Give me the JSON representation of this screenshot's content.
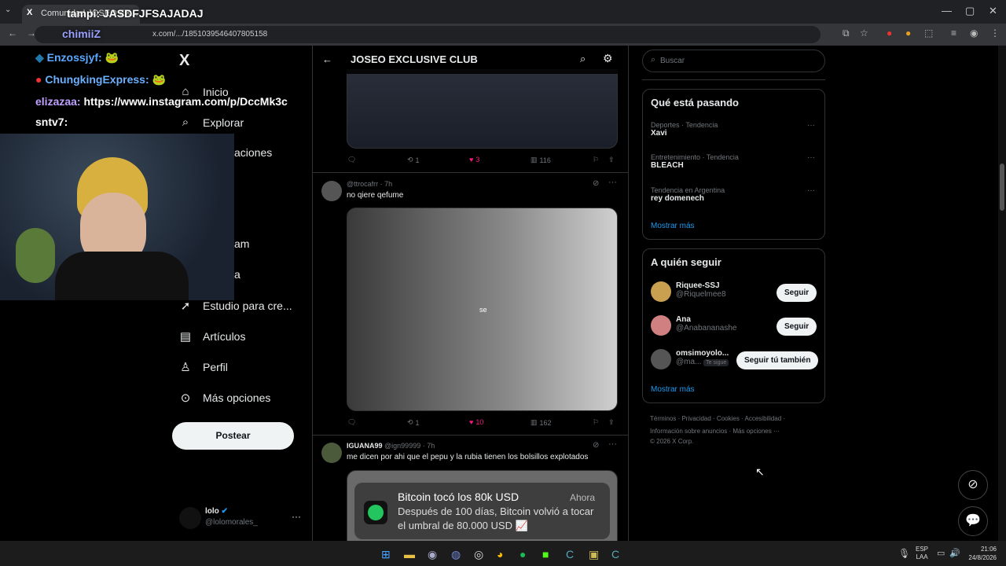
{
  "browser": {
    "tab_title": "Comunidad JOSEO EX...",
    "url": "x.com/.../1851039546407805158",
    "window_controls": {
      "minimize": "—",
      "maximize": "▢",
      "close": "✕"
    }
  },
  "overlay": {
    "chat": [
      {
        "user": "tampi",
        "text": ": JASDFJFSAJADAJ",
        "color": "#ffffff"
      },
      {
        "user": "chimiiZ",
        "text": "",
        "color": "#9aa0ff"
      },
      {
        "user": "Enzossjyf:",
        "text": "",
        "color": "#5aa8ff"
      },
      {
        "user": "ChungkingExpress:",
        "text": "",
        "color": "#6ab0ff"
      },
      {
        "user": "elizazaa:",
        "text": " https://www.instagram.com/p/DccMk3c",
        "color": "#c0a0ff"
      },
      {
        "user": "sntv7:",
        "text": "",
        "color": "#ffffff"
      }
    ]
  },
  "sidebar": {
    "logo": "X",
    "items": [
      {
        "label": "Inicio",
        "icon": "home-icon"
      },
      {
        "label": "Explorar",
        "icon": "search-icon"
      },
      {
        "label": "aciones",
        "icon": "bell-icon"
      },
      {
        "label": "am",
        "icon": "grok-icon"
      },
      {
        "label": "a",
        "icon": "bookmark-icon"
      },
      {
        "label": "Estudio para cre...",
        "icon": "rocket-icon"
      },
      {
        "label": "Artículos",
        "icon": "article-icon"
      },
      {
        "label": "Perfil",
        "icon": "person-icon"
      },
      {
        "label": "Más opciones",
        "icon": "more-icon"
      }
    ],
    "post_button": "Postear",
    "account": {
      "name": "lolo",
      "handle": "@lolomorales_"
    }
  },
  "header": {
    "title": "JOSEO EXCLUSIVE CLUB"
  },
  "posts": [
    {
      "reply": "",
      "repost": "1",
      "likes": "3",
      "views": "116"
    },
    {
      "display_name": "",
      "handle": "@ttrocafrr",
      "time": "· 7h",
      "text": "no qiere qefume",
      "media_caption": "se",
      "reply": "",
      "repost": "1",
      "likes": "10",
      "views": "162"
    },
    {
      "display_name": "IGUANA99",
      "handle": "@ign99999",
      "time": "· 7h",
      "text": "me dicen por ahi que el pepu y la rubia tienen los bolsillos explotados"
    }
  ],
  "notification": {
    "title": "Bitcoin tocó los 80k USD",
    "time": "Ahora",
    "body": "Después de 100 días, Bitcoin volvió a tocar el umbral de 80.000 USD 📈"
  },
  "search": {
    "placeholder": "Buscar"
  },
  "trends": {
    "title": "Qué está pasando",
    "items": [
      {
        "meta": "Deportes · Tendencia",
        "name": "Xavi"
      },
      {
        "meta": "Entretenimiento · Tendencia",
        "name": "BLEACH"
      },
      {
        "meta": "Tendencia en Argentina",
        "name": "rey domenech"
      }
    ],
    "more": "Mostrar más"
  },
  "who_to_follow": {
    "title": "A quién seguir",
    "items": [
      {
        "name": "Riquee-SSJ",
        "handle": "@Riquelmee8",
        "button": "Seguir",
        "badge": ""
      },
      {
        "name": "Ana",
        "handle": "@Anabananashe",
        "button": "Seguir",
        "badge": ""
      },
      {
        "name": "omsimoyolo...",
        "handle": "@ma...",
        "button": "Seguir tú también",
        "badge": "Te sigue"
      }
    ],
    "more": "Mostrar más"
  },
  "footer": {
    "line1": [
      "Términos",
      "Privacidad",
      "Cookies",
      "Accesibilidad"
    ],
    "line2": [
      "Información sobre anuncios",
      "Más opciones ···"
    ],
    "copyright": "© 2026 X Corp."
  },
  "taskbar": {
    "lang": "ESP",
    "lang2": "LAA",
    "time": "21:06",
    "date": "24/8/2026"
  },
  "colors": {
    "accent": "#1d9bf0",
    "like": "#f91880",
    "border": "#2f3336"
  }
}
